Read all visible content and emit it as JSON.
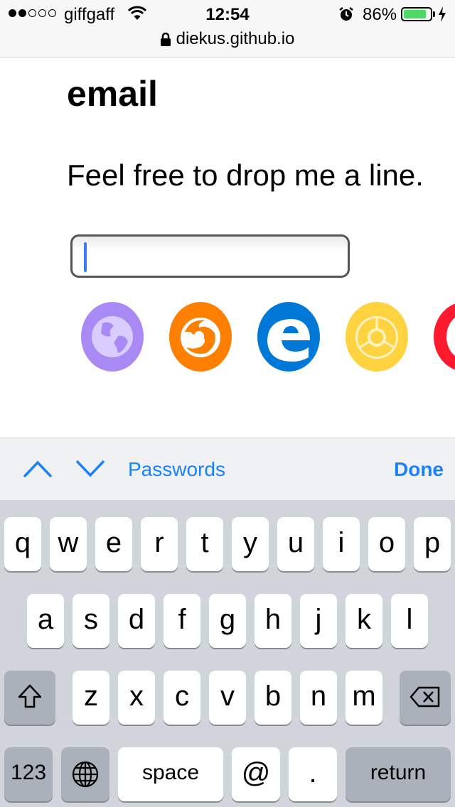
{
  "status_bar": {
    "carrier": "giffgaff",
    "time": "12:54",
    "battery_percent": "86%",
    "battery_level": 0.86,
    "signal_bars": [
      true,
      true,
      false,
      false,
      false
    ]
  },
  "url_bar": {
    "url": "diekus.github.io"
  },
  "page": {
    "heading": "email",
    "line": "Feel free to drop me a line.",
    "email_input": {
      "value": ""
    },
    "browsers": [
      "browser-globe",
      "firefox",
      "edge",
      "chrome",
      "opera"
    ]
  },
  "accessory": {
    "passwords_label": "Passwords",
    "done_label": "Done"
  },
  "keyboard": {
    "row1": [
      "q",
      "w",
      "e",
      "r",
      "t",
      "y",
      "u",
      "i",
      "o",
      "p"
    ],
    "row2": [
      "a",
      "s",
      "d",
      "f",
      "g",
      "h",
      "j",
      "k",
      "l"
    ],
    "row3": [
      "z",
      "x",
      "c",
      "v",
      "b",
      "n",
      "m"
    ],
    "numbers_label": "123",
    "space_label": "space",
    "at_label": "@",
    "period_label": ".",
    "return_label": "return"
  },
  "colors": {
    "accent": "#1a82fb",
    "battery": "#4cd964",
    "keyboard_bg": "#d1d5db"
  }
}
